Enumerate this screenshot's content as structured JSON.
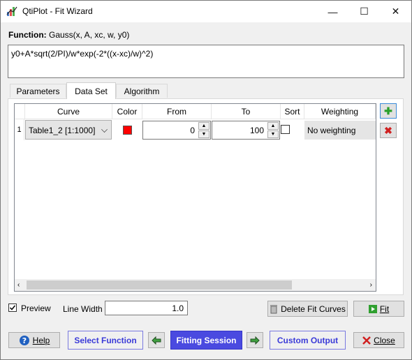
{
  "window": {
    "title": "QtiPlot - Fit Wizard",
    "minimize_glyph": "—",
    "maximize_glyph": "☐",
    "close_glyph": "✕"
  },
  "function": {
    "label": "Function:",
    "signature": "Gauss(x, A, xc, w, y0)",
    "formula": "y0+A*sqrt(2/PI)/w*exp(-2*((x-xc)/w)^2)"
  },
  "tabs": [
    {
      "label": "Parameters",
      "underline": "P"
    },
    {
      "label": "Data Set",
      "underline": "D"
    },
    {
      "label": "Algorithm",
      "underline": "A"
    }
  ],
  "table": {
    "columns": [
      "Curve",
      "Color",
      "From",
      "To",
      "Sort",
      "Weighting"
    ],
    "rows": [
      {
        "index": "1",
        "curve": "Table1_2 [1:1000]",
        "color": "#ff0000",
        "from": "0",
        "to": "100",
        "sort": false,
        "weighting": "No weighting"
      }
    ]
  },
  "side_buttons": {
    "add_glyph": "✚",
    "remove_glyph": "✖"
  },
  "options": {
    "preview_label": "Preview",
    "preview_checked": true,
    "line_width_label": "Line Width",
    "line_width_value": "1.0",
    "delete_fit_curves": "Delete Fit Curves",
    "fit": "Fit"
  },
  "footer": {
    "help": "Help",
    "select_function": "Select Function",
    "fitting_session": "Fitting Session",
    "custom_output": "Custom Output",
    "close": "Close"
  }
}
